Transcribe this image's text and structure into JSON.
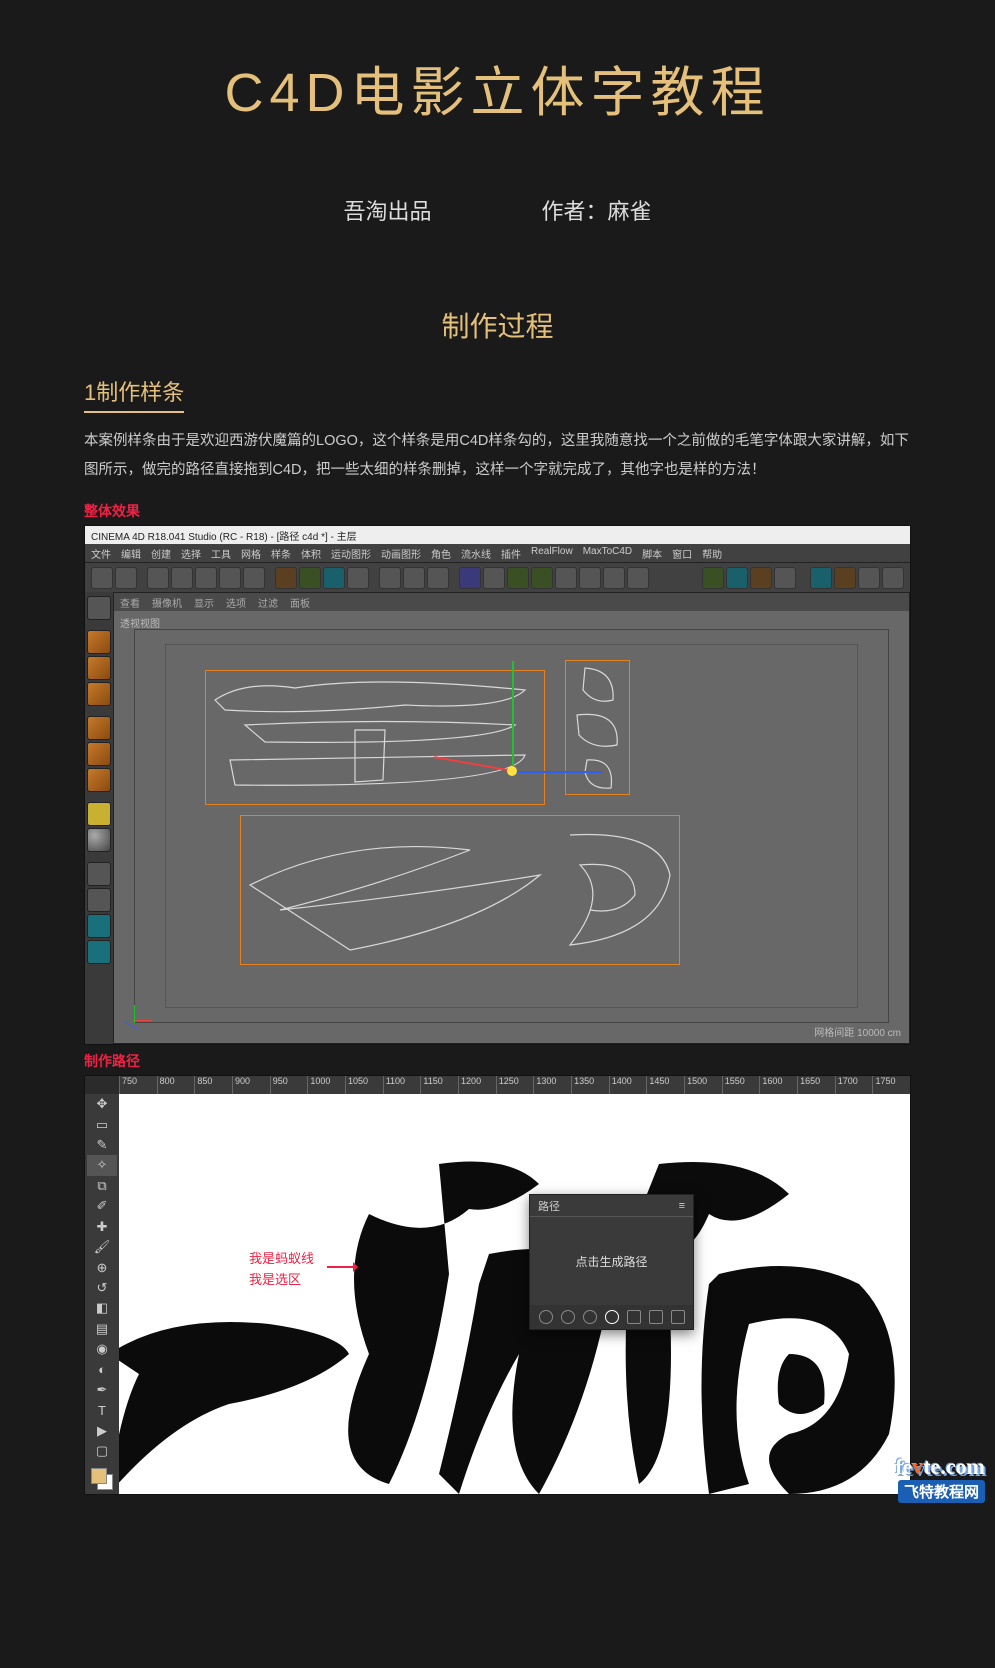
{
  "banner": {
    "title": "C4D电影立体字教程"
  },
  "credits": {
    "studio": "吾淘出品",
    "author_label": "作者：麻雀"
  },
  "section": {
    "process": "制作过程"
  },
  "step1": {
    "title": "1制作样条",
    "desc": "本案例样条由于是欢迎西游伏魔篇的LOGO，这个样条是用C4D样条勾的，这里我随意找一个之前做的毛笔字体跟大家讲解，如下图所示，做完的路径直接拖到C4D，把一些太细的样条删掉，这样一个字就完成了，其他字也是样的方法！"
  },
  "labels": {
    "overall": "整体效果",
    "mk_path": "制作路径"
  },
  "c4d": {
    "title": "CINEMA 4D R18.041 Studio (RC - R18) - [路径 c4d *] - 主层",
    "menus": [
      "文件",
      "编辑",
      "创建",
      "选择",
      "工具",
      "网格",
      "样条",
      "体积",
      "运动图形",
      "动画图形",
      "角色",
      "流水线",
      "插件",
      "RealFlow",
      "MaxToC4D",
      "脚本",
      "窗口",
      "帮助"
    ],
    "viewport_tabs": [
      "查看",
      "摄像机",
      "显示",
      "选项",
      "过滤",
      "面板"
    ],
    "viewport_label": "透视视图",
    "status_right": "网格间距   10000 cm"
  },
  "ps": {
    "ruler": [
      "750",
      "800",
      "850",
      "900",
      "950",
      "1000",
      "1050",
      "1100",
      "1150",
      "1200",
      "1250",
      "1300",
      "1350",
      "1400",
      "1450",
      "1500",
      "1550",
      "1600",
      "1650",
      "1700",
      "1750"
    ],
    "anno_line1": "我是蚂蚁线",
    "anno_line2": "我是选区",
    "panel_title": "路径",
    "panel_body": "点击生成路径"
  },
  "watermark": {
    "brand_a": "fe",
    "brand_b": "v",
    "brand_c": "te",
    "brand_d": ".com",
    "sub": "飞特教程网"
  }
}
